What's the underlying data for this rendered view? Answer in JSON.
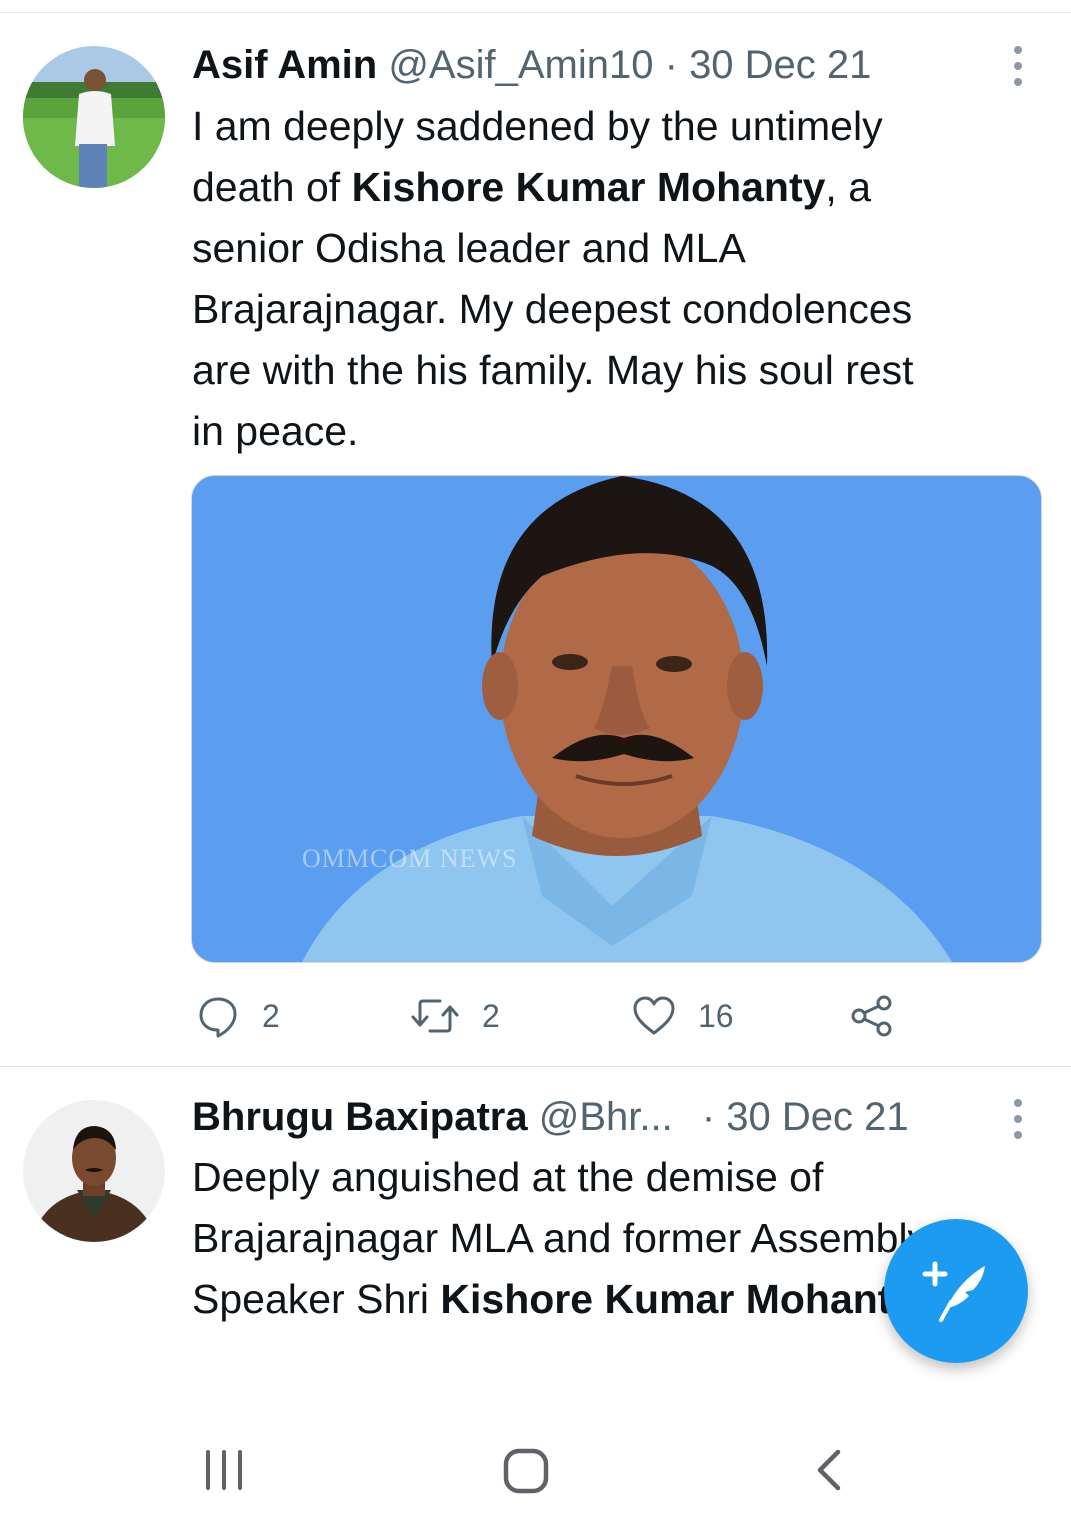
{
  "tweets": [
    {
      "name": "Asif Amin",
      "handle": "@Asif_Amin10",
      "separator": "·",
      "date": "30 Dec 21",
      "text_parts": [
        {
          "t": "I am deeply saddened by the untimely\ndeath of ",
          "bold": false
        },
        {
          "t": "Kishore Kumar Mohanty",
          "bold": true
        },
        {
          "t": ", a\nsenior Odisha leader and MLA\nBrajarajnagar. My deepest condolences\nare with the his family. May his soul rest\nin peace.",
          "bold": false
        }
      ],
      "media_watermark": "OMMCOM NEWS",
      "actions": {
        "replies": "2",
        "retweets": "2",
        "likes": "16"
      }
    },
    {
      "name": "Bhrugu Baxipatra",
      "handle": "@Bhr...",
      "separator": "·",
      "date": "30 Dec 21",
      "text_parts": [
        {
          "t": "Deeply anguished at the demise of\nBrajarajnagar MLA and former Assembly\nSpeaker Shri ",
          "bold": false
        },
        {
          "t": "Kishore Kumar Mohanty",
          "bold": true
        }
      ]
    }
  ],
  "icons": {
    "reply": "speech-bubble-icon",
    "retweet": "retweet-arrows-icon",
    "like": "heart-icon",
    "share": "share-nodes-icon",
    "more": "vertical-dots-icon",
    "compose": "feather-plus-icon",
    "nav_recents": "recents-lines-icon",
    "nav_home": "home-rounded-square-icon",
    "nav_back": "back-chevron-icon"
  },
  "colors": {
    "accent": "#1d9bf0",
    "secondary_text": "#536471",
    "media_background": "#5b9ef0"
  }
}
